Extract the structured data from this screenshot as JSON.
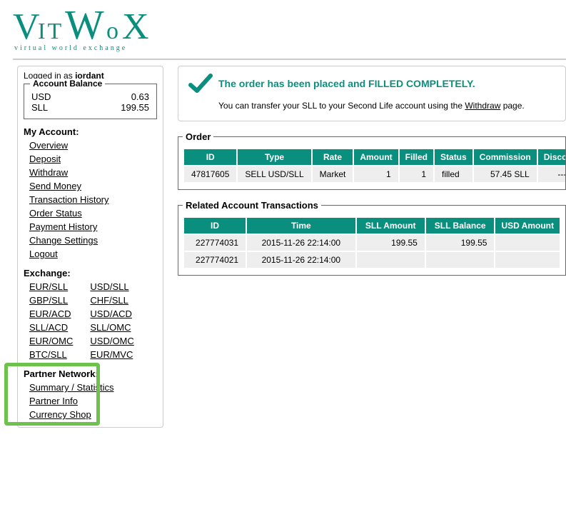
{
  "logo": {
    "brand": "VirWoX",
    "tagline": "virtual world exchange"
  },
  "login": {
    "prefix": "Logged in as ",
    "user": "jordant"
  },
  "balance": {
    "legend": "Account Balance",
    "rows": [
      {
        "currency": "USD",
        "amount": "0.63"
      },
      {
        "currency": "SLL",
        "amount": "199.55"
      }
    ]
  },
  "account_section": {
    "title": "My Account:",
    "links": [
      "Overview",
      "Deposit",
      "Withdraw",
      "Send Money",
      "Transaction History",
      "Order Status",
      "Payment History",
      "Change Settings",
      "Logout"
    ]
  },
  "exchange_section": {
    "title": "Exchange:",
    "col1": [
      "EUR/SLL",
      "GBP/SLL",
      "EUR/ACD",
      "SLL/ACD",
      "EUR/OMC",
      "BTC/SLL"
    ],
    "col2": [
      "USD/SLL",
      "CHF/SLL",
      "USD/ACD",
      "SLL/OMC",
      "USD/OMC",
      "EUR/MVC"
    ]
  },
  "partner_section": {
    "title": "Partner Network:",
    "links": [
      "Summary / Statistics",
      "Partner Info",
      "Currency Shop"
    ]
  },
  "success": {
    "message": "The order has been placed and FILLED COMPLETELY.",
    "note_pre": "You can transfer your SLL to your Second Life account using the ",
    "note_link": "Withdraw",
    "note_post": " page."
  },
  "order": {
    "legend": "Order",
    "headers": [
      "ID",
      "Type",
      "Rate",
      "Amount",
      "Filled",
      "Status",
      "Commission",
      "Discount"
    ],
    "row": {
      "id": "47817605",
      "type": "SELL USD/SLL",
      "rate": "Market",
      "amount": "1",
      "filled": "1",
      "status": "filled",
      "commission": "57.45 SLL",
      "discount": "---"
    }
  },
  "transactions": {
    "legend": "Related Account Transactions",
    "headers": [
      "ID",
      "Time",
      "SLL Amount",
      "SLL Balance",
      "USD Amount"
    ],
    "rows": [
      {
        "id": "227774031",
        "time": "2015-11-26 22:14:00",
        "sll_amount": "199.55",
        "sll_balance": "199.55"
      },
      {
        "id": "227774021",
        "time": "2015-11-26 22:14:00",
        "sll_amount": "",
        "sll_balance": ""
      }
    ]
  }
}
